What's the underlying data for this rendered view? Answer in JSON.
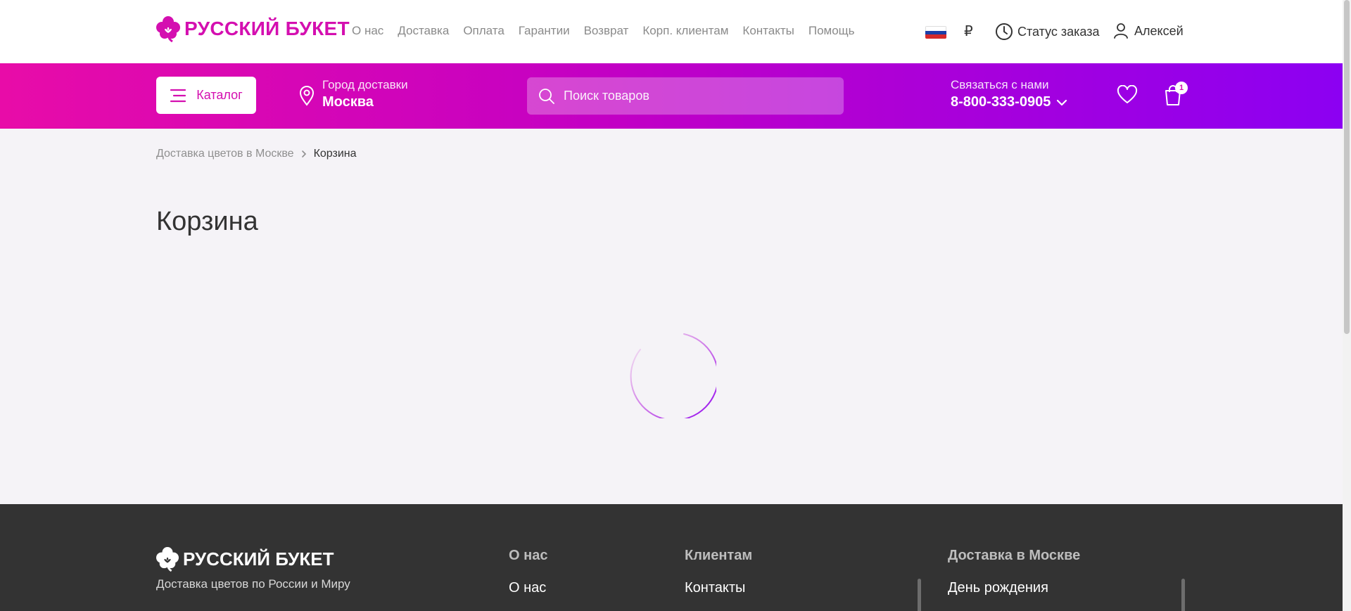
{
  "brand": {
    "name": "РУССКИЙ БУКЕТ",
    "accent_color": "#d40fb0",
    "gradient_start": "#e80ca8",
    "gradient_end": "#8c00f2"
  },
  "top_nav": {
    "links": [
      "О нас",
      "Доставка",
      "Оплата",
      "Гарантии",
      "Возврат",
      "Корп. клиентам",
      "Контакты",
      "Помощь"
    ],
    "currency_symbol": "₽",
    "order_status_label": "Статус заказа",
    "user_name": "Алексей"
  },
  "main_bar": {
    "catalog_label": "Каталог",
    "city_label": "Город доставки",
    "city_name": "Москва",
    "search_placeholder": "Поиск товаров",
    "contact_label": "Связаться с нами",
    "phone": "8-800-333-0905",
    "cart_count": "1"
  },
  "breadcrumb": {
    "link_label": "Доставка цветов в Москве",
    "current_label": "Корзина"
  },
  "page": {
    "title": "Корзина"
  },
  "footer": {
    "brand_name": "РУССКИЙ БУКЕТ",
    "tagline": "Доставка цветов по России и Миру",
    "col_about_title": "О нас",
    "col_about_link": "О нас",
    "col_clients_title": "Клиентам",
    "col_clients_link": "Контакты",
    "col_delivery_title": "Доставка в Москве",
    "col_delivery_link": "День рождения"
  },
  "icons": [
    "logo-flower-icon",
    "flag-russia-icon",
    "clock-icon",
    "user-icon",
    "hamburger-icon",
    "location-pin-icon",
    "search-icon",
    "chevron-down-icon",
    "heart-icon",
    "cart-bag-icon",
    "loading-spinner-icon"
  ]
}
